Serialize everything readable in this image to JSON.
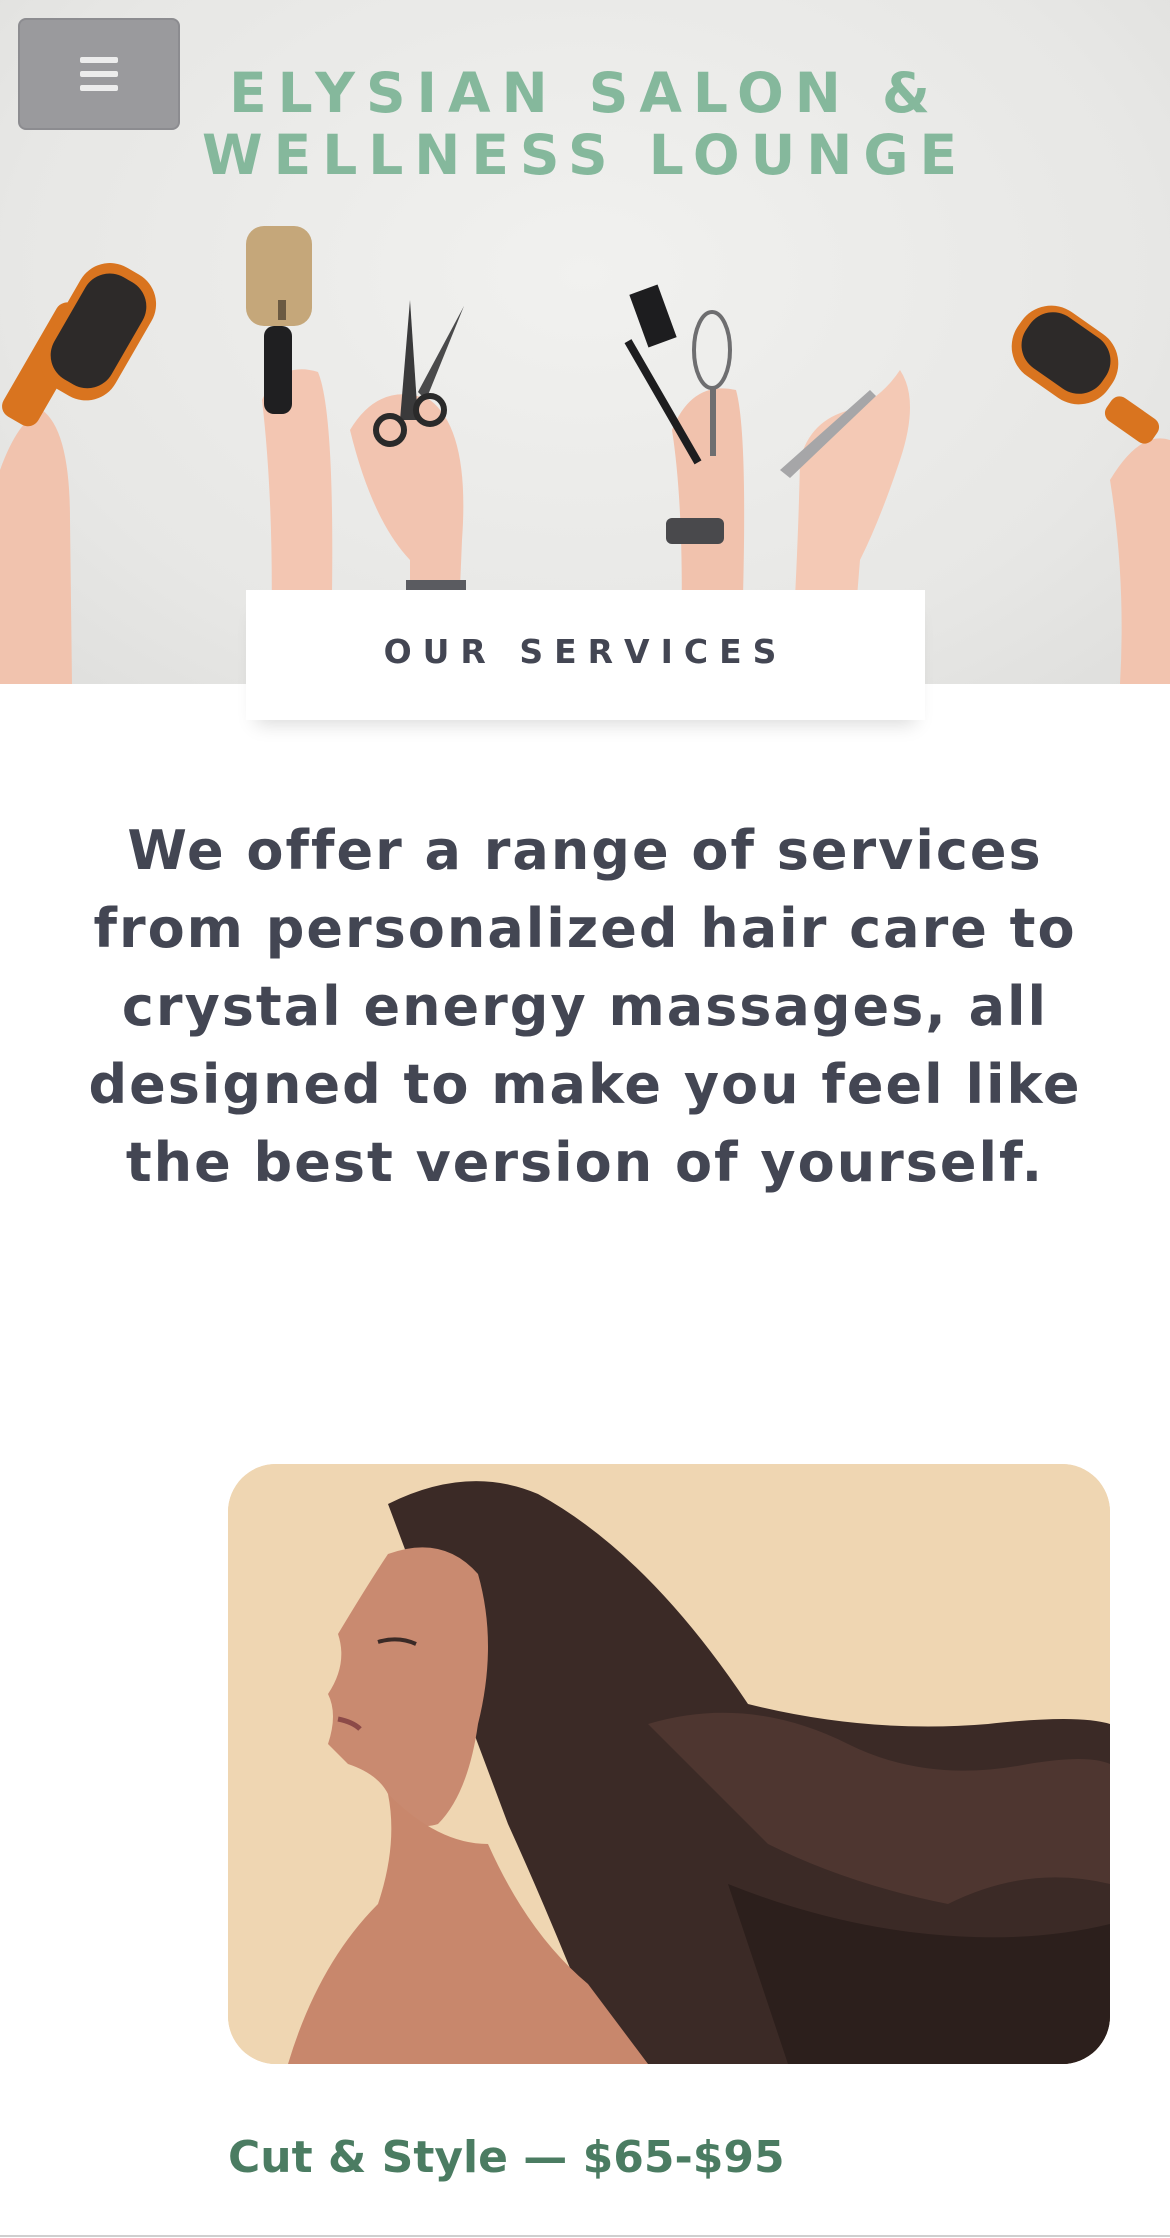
{
  "header": {
    "menu_icon": "hamburger-menu-icon",
    "title_line1": "ELYSIAN SALON &",
    "title_line2": "WELLNESS LOUNGE",
    "title_color": "#85b89c"
  },
  "hero": {
    "image_subject": "hands holding hairbrushes, scissors and tools"
  },
  "services": {
    "tab_label": "OUR SERVICES",
    "intro": "We offer a range of services from personalized hair care to crystal energy massages, all designed to make you feel like the best version of yourself.",
    "items": [
      {
        "caption": "Cut & Style — $65-$95",
        "caption_color": "#4b7c62"
      }
    ]
  },
  "colors": {
    "text": "#434653",
    "accent": "#85b89c",
    "photo_background": "#efd6b2"
  }
}
